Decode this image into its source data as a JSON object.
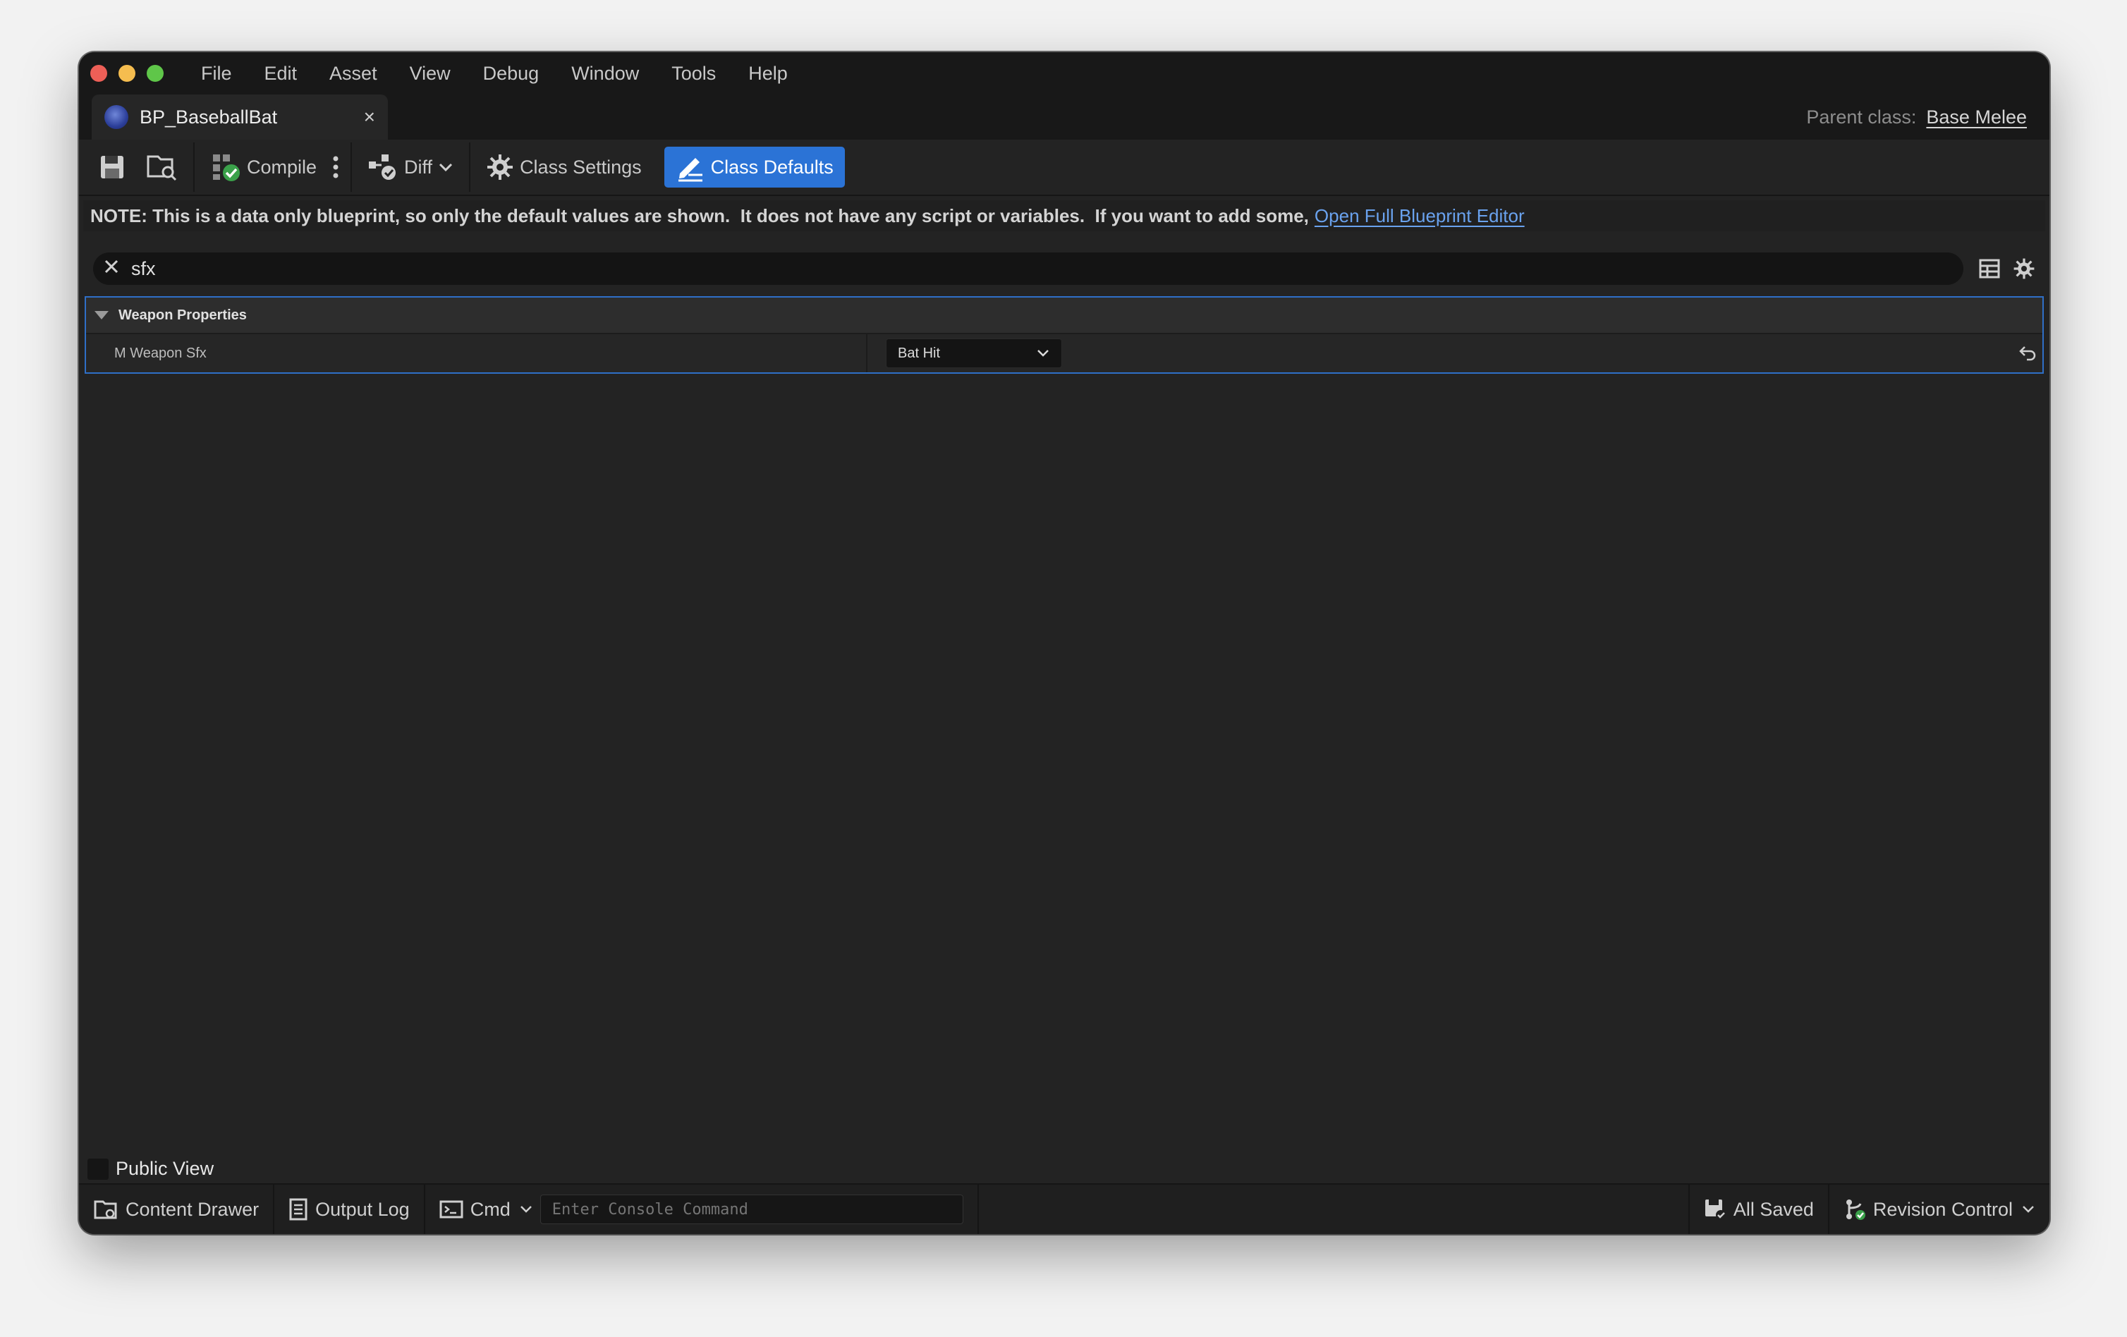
{
  "menu": [
    "File",
    "Edit",
    "Asset",
    "View",
    "Debug",
    "Window",
    "Tools",
    "Help"
  ],
  "tab": {
    "title": "BP_BaseballBat",
    "close": "×"
  },
  "parent_class": {
    "label": "Parent class:",
    "value": "Base Melee"
  },
  "toolbar": {
    "compile_label": "Compile",
    "diff_label": "Diff",
    "class_settings_label": "Class Settings",
    "class_defaults_label": "Class Defaults"
  },
  "note": {
    "text": "NOTE: This is a data only blueprint, so only the default values are shown.  It does not have any script or variables.  If you want to add some,",
    "link": "Open Full Blueprint Editor"
  },
  "search": {
    "value": "sfx"
  },
  "details": {
    "category": "Weapon Properties",
    "property_name": "M Weapon Sfx",
    "property_value": "Bat Hit"
  },
  "public_view_label": "Public View",
  "statusbar": {
    "content_drawer": "Content Drawer",
    "output_log": "Output Log",
    "cmd": "Cmd",
    "console_placeholder": "Enter Console Command",
    "all_saved": "All Saved",
    "revision_control": "Revision Control"
  },
  "colors": {
    "accent": "#2b73d6",
    "link": "#6aa2ee",
    "selection_border": "#2f6fc7"
  }
}
